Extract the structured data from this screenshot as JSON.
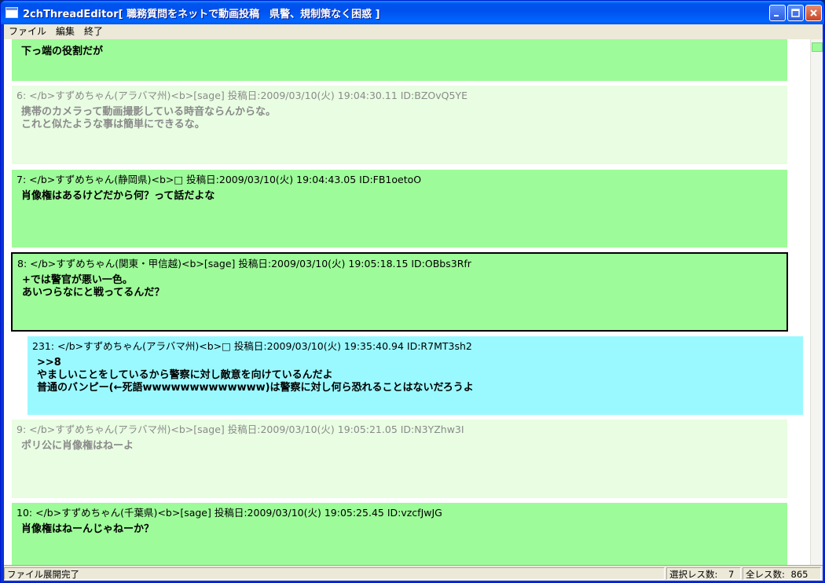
{
  "window": {
    "title": "2chThreadEditor[ 職務質問をネットで動画投稿　県警、規制策なく困惑 ]"
  },
  "menu": {
    "file": "ファイル",
    "edit": "編集",
    "exit": "終了"
  },
  "posts": [
    {
      "header": "",
      "body": "下っ端の役割だが"
    },
    {
      "header": "6:  </b>すずめちゃん(アラバマ州)<b>[sage] 投稿日:2009/03/10(火) 19:04:30.11 ID:BZOvQ5YE",
      "body": "携帯のカメラって動画撮影している時音ならんからな。\nこれと似たような事は簡単にできるな。"
    },
    {
      "header": "7:  </b>すずめちゃん(静岡県)<b>□ 投稿日:2009/03/10(火) 19:04:43.05 ID:FB1oetoO",
      "body": "肖像権はあるけどだから何？って話だよな"
    },
    {
      "header": "8:  </b>すずめちゃん(関東・甲信越)<b>[sage] 投稿日:2009/03/10(火) 19:05:18.15 ID:OBbs3Rfr",
      "body": "+では警官が悪い一色。\nあいつらなにと戦ってるんだ？"
    },
    {
      "header": "231:  </b>すずめちゃん(アラバマ州)<b>□ 投稿日:2009/03/10(火) 19:35:40.94 ID:R7MT3sh2",
      "body": ">>8\nやましいことをしているから警察に対し敵意を向けているんだよ\n普通のバンピー(←死語wwwwwwwwwwwww)は警察に対し何ら恐れることはないだろうよ"
    },
    {
      "header": "9:  </b>すずめちゃん(アラバマ州)<b>[sage] 投稿日:2009/03/10(火) 19:05:21.05 ID:N3YZhw3I",
      "body": "ポリ公に肖像権はねーよ"
    },
    {
      "header": "10:  </b>すずめちゃん(千葉県)<b>[sage] 投稿日:2009/03/10(火) 19:05:25.45 ID:vzcfJwJG",
      "body": "肖像権はねーんじゃねーか？"
    }
  ],
  "status": {
    "message": "ファイル展開完了",
    "selected_label": "選択レス数:",
    "selected_count": "7",
    "total_label": "全レス数:",
    "total_count": "865"
  },
  "colors": {
    "normal_post": "#9efb99",
    "faded_post": "#e8fde2",
    "reply_post": "#9af9ff"
  },
  "icons": {
    "minimize": "minimize-icon",
    "maximize": "maximize-icon",
    "close": "close-icon"
  }
}
